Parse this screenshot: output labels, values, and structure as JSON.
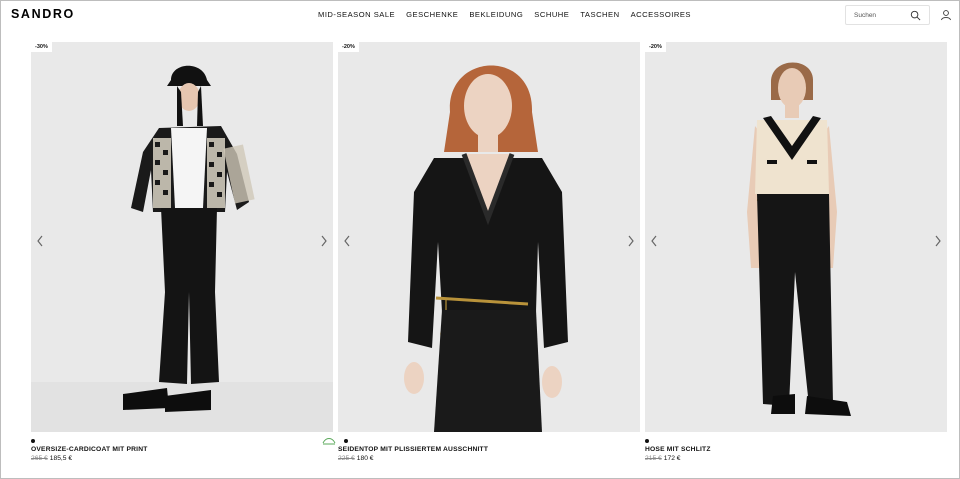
{
  "brand": "SANDRO",
  "nav": [
    "MID-SEASON SALE",
    "GESCHENKE",
    "BEKLEIDUNG",
    "SCHUHE",
    "TASCHEN",
    "ACCESSOIRES"
  ],
  "search": {
    "placeholder": "Suchen"
  },
  "products": [
    {
      "discount": "-30%",
      "name": "OVERSIZE-CARDICOAT MIT PRINT",
      "old_price": "265 €",
      "price": "185,5 €"
    },
    {
      "discount": "-20%",
      "name": "SEIDENTOP MIT PLISSIERTEM AUSSCHNITT",
      "old_price": "225 €",
      "price": "180 €"
    },
    {
      "discount": "-20%",
      "name": "HOSE MIT SCHLITZ",
      "old_price": "215 €",
      "price": "172 €"
    }
  ],
  "colors": {
    "photo_bg": "#e8e8e8",
    "text": "#111111",
    "eco": "#5aa85a"
  }
}
